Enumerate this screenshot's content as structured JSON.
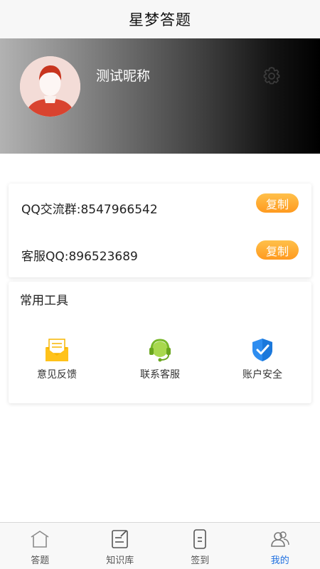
{
  "header": {
    "title": "星梦答题"
  },
  "profile": {
    "nickname": "测试昵称",
    "settings_icon": "gear-icon"
  },
  "contacts": [
    {
      "label": "QQ交流群:8547966542",
      "button": "复制"
    },
    {
      "label": "客服QQ:896523689",
      "button": "复制"
    }
  ],
  "tools": {
    "title": "常用工具",
    "items": [
      {
        "label": "意见反馈",
        "icon": "feedback-envelope-icon"
      },
      {
        "label": "联系客服",
        "icon": "headset-icon"
      },
      {
        "label": "账户安全",
        "icon": "shield-check-icon"
      }
    ]
  },
  "tabbar": {
    "items": [
      {
        "label": "答题",
        "icon": "home-icon",
        "active": false
      },
      {
        "label": "知识库",
        "icon": "notebook-pen-icon",
        "active": false
      },
      {
        "label": "签到",
        "icon": "checkin-phone-icon",
        "active": false
      },
      {
        "label": "我的",
        "icon": "people-icon",
        "active": true
      }
    ]
  },
  "colors": {
    "accent": "#1e6fe0",
    "copy_button": "#ff9a1f",
    "profile_gradient_start": "#b2b2b2",
    "profile_gradient_end": "#000000"
  }
}
